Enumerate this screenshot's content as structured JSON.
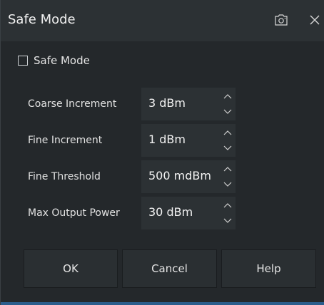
{
  "dialog": {
    "title": "Safe Mode"
  },
  "icons": {
    "camera": "camera-icon",
    "close": "close-icon",
    "spin_up": "chevron-up-icon",
    "spin_down": "chevron-down-icon"
  },
  "safe_mode": {
    "label": "Safe Mode",
    "checked": false
  },
  "fields": [
    {
      "label": "Coarse Increment",
      "value": "3 dBm"
    },
    {
      "label": "Fine Increment",
      "value": "1 dBm"
    },
    {
      "label": "Fine Threshold",
      "value": "500 mdBm"
    },
    {
      "label": "Max Output Power",
      "value": "30 dBm"
    }
  ],
  "buttons": {
    "ok": "OK",
    "cancel": "Cancel",
    "help": "Help"
  },
  "colors": {
    "background": "#24282b",
    "titlebar": "#2c3134",
    "field": "#2c3134",
    "button": "#2a2f32",
    "accent": "#2b5d8c"
  }
}
